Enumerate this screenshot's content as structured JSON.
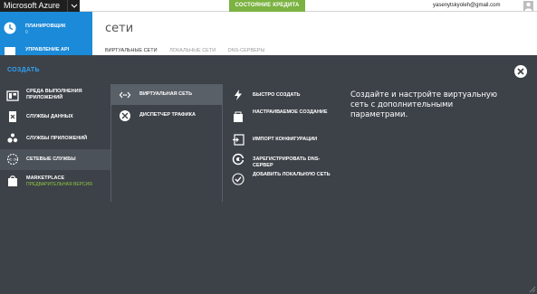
{
  "topbar": {
    "brand": "Microsoft Azure",
    "credit_label": "СОСТОЯНИЕ КРЕДИТА",
    "user_email": "yasenytskyoleh@gmail.com"
  },
  "background": {
    "nav_items": [
      {
        "label": "ПЛАНИРОВЩИК",
        "count": "0"
      },
      {
        "label": "УПРАВЛЕНИЕ API",
        "count": ""
      }
    ],
    "page_title": "сети",
    "tabs": [
      "ВИРТУАЛЬНЫЕ СЕТИ",
      "ЛОКАЛЬНЫЕ СЕТИ",
      "DNS-СЕРВЕРЫ"
    ]
  },
  "panel": {
    "title": "СОЗДАТЬ",
    "categories": [
      {
        "label": "СРЕДА ВЫПОЛНЕНИЯ ПРИЛОЖЕНИЙ",
        "icon": "app-runtime-icon"
      },
      {
        "label": "СЛУЖБЫ ДАННЫХ",
        "icon": "data-services-icon"
      },
      {
        "label": "СЛУЖБЫ ПРИЛОЖЕНИЙ",
        "icon": "app-services-icon"
      },
      {
        "label": "СЕТЕВЫЕ СЛУЖБЫ",
        "icon": "network-services-icon",
        "selected": true
      },
      {
        "label": "MARKETPLACE",
        "sublabel": "ПРЕДВАРИТЕЛЬНАЯ ВЕРСИЯ",
        "icon": "marketplace-bag-icon"
      }
    ],
    "services": [
      {
        "label": "ВИРТУАЛЬНАЯ СЕТЬ",
        "icon": "virtual-network-icon",
        "selected": true
      },
      {
        "label": "ДИСПЕТЧЕР ТРАФИКА",
        "icon": "traffic-manager-icon"
      }
    ],
    "options": [
      {
        "label": "БЫСТРО СОЗДАТЬ",
        "icon": "lightning-icon"
      },
      {
        "label": "НАСТРАИВАЕМОЕ СОЗДАНИЕ",
        "icon": "custom-create-icon"
      },
      {
        "label": "ИМПОРТ КОНФИГУРАЦИИ",
        "icon": "import-config-icon"
      },
      {
        "label": "ЗАРЕГИСТРИРОВАТЬ DNS-СЕРВЕР",
        "icon": "dns-server-icon"
      },
      {
        "label": "ДОБАВИТЬ ЛОКАЛЬНУЮ СЕТЬ",
        "icon": "add-local-network-icon"
      }
    ],
    "description": "Создайте и настройте виртуальную сеть с дополнительными параметрами."
  },
  "colors": {
    "accent_blue": "#2ea3f2",
    "nav_blue": "#1b8ad8",
    "credit_green": "#7bb241",
    "panel_bg": "#3d4249",
    "preview_green": "#8cc63f"
  }
}
